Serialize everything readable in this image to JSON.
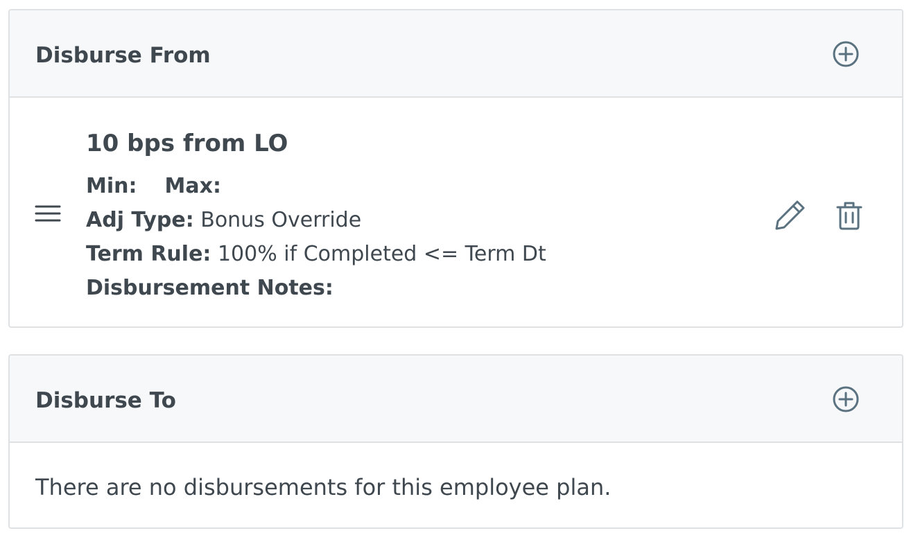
{
  "disburse_from": {
    "title": "Disburse From",
    "add_icon": "plus-circle-icon",
    "items": [
      {
        "name": "10 bps from LO",
        "min_label": "Min:",
        "min_value": "",
        "max_label": "Max:",
        "max_value": "",
        "adj_type_label": "Adj Type:",
        "adj_type_value": "Bonus Override",
        "term_rule_label": "Term Rule:",
        "term_rule_value": "100% if Completed <= Term Dt",
        "notes_label": "Disbursement Notes:",
        "notes_value": "",
        "drag_icon": "drag-handle-icon",
        "edit_icon": "pencil-icon",
        "delete_icon": "trash-icon"
      }
    ]
  },
  "disburse_to": {
    "title": "Disburse To",
    "add_icon": "plus-circle-icon",
    "empty_message": "There are no disbursements for this employee plan."
  },
  "colors": {
    "text": "#3f474f",
    "icon": "#5a7280",
    "header_bg": "#f7f8f9",
    "border": "#dfe2e5"
  }
}
